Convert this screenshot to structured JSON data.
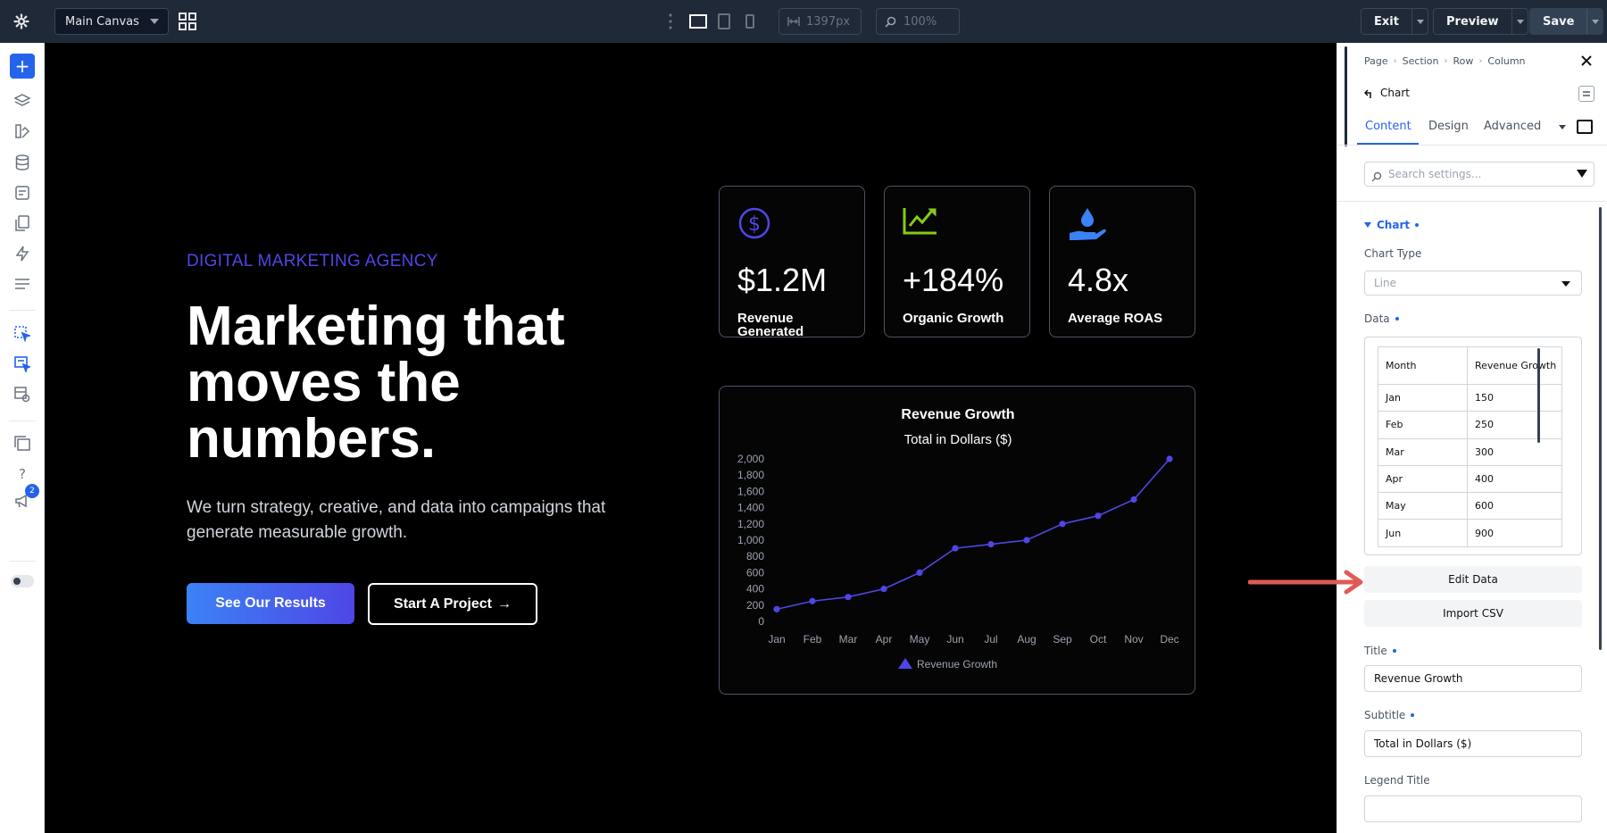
{
  "topbar": {
    "canvas_select": "Main Canvas",
    "width_field": "1397px",
    "zoom_field": "100%",
    "exit_label": "Exit",
    "preview_label": "Preview",
    "save_label": "Save"
  },
  "icons": {
    "gear": "gear-icon",
    "grid": "grid-icon",
    "add": "plus-icon",
    "layers": "layers-icon",
    "help": "question-icon"
  },
  "sidebar": {
    "badge_count": "2"
  },
  "hero": {
    "eyebrow": "DIGITAL MARKETING AGENCY",
    "headline": "Marketing that moves the numbers.",
    "subtext": "We turn strategy, creative, and data into campaigns that generate measurable growth.",
    "primary_button": "See Our Results",
    "secondary_button": "Start A Project",
    "secondary_arrow": "→"
  },
  "stats": [
    {
      "value": "$1.2M",
      "label": "Revenue Generated",
      "color": "#4f46e5"
    },
    {
      "value": "+184%",
      "label": "Organic Growth",
      "color": "#84cc16"
    },
    {
      "value": "4.8x",
      "label": "Average ROAS",
      "color": "#3b82f6"
    }
  ],
  "chart_data": {
    "type": "line",
    "title": "Revenue Growth",
    "subtitle": "Total in Dollars ($)",
    "categories": [
      "Jan",
      "Feb",
      "Mar",
      "Apr",
      "May",
      "Jun",
      "Jul",
      "Aug",
      "Sep",
      "Oct",
      "Nov",
      "Dec"
    ],
    "series": [
      {
        "name": "Revenue Growth",
        "values": [
          150,
          250,
          300,
          400,
          600,
          900,
          950,
          1000,
          1200,
          1300,
          1500,
          2000
        ],
        "color": "#4f46e5"
      }
    ],
    "ylim": [
      0,
      2000
    ],
    "yticks": [
      "0",
      "200",
      "400",
      "600",
      "800",
      "1,000",
      "1,200",
      "1,400",
      "1,600",
      "1,800",
      "2,000"
    ],
    "grid": false,
    "legend": "bottom"
  },
  "panel": {
    "breadcrumb": [
      "Page",
      "Section",
      "Row",
      "Column"
    ],
    "module_title": "Chart",
    "tabs": [
      "Content",
      "Design",
      "Advanced"
    ],
    "search_placeholder": "Search settings...",
    "group_label": "Chart",
    "chart_type_label": "Chart Type",
    "chart_type_value": "Line",
    "data_label": "Data",
    "table_headers": [
      "Month",
      "Revenue Growth"
    ],
    "table_rows": [
      [
        "Jan",
        "150"
      ],
      [
        "Feb",
        "250"
      ],
      [
        "Mar",
        "300"
      ],
      [
        "Apr",
        "400"
      ],
      [
        "May",
        "600"
      ],
      [
        "Jun",
        "900"
      ]
    ],
    "edit_data_button": "Edit Data",
    "import_csv_button": "Import CSV",
    "title_label": "Title",
    "title_value": "Revenue Growth",
    "subtitle_label": "Subtitle",
    "subtitle_value": "Total in Dollars ($)",
    "legend_title_label": "Legend Title",
    "legend_title_value": ""
  },
  "annotation_color": "#e05a55"
}
